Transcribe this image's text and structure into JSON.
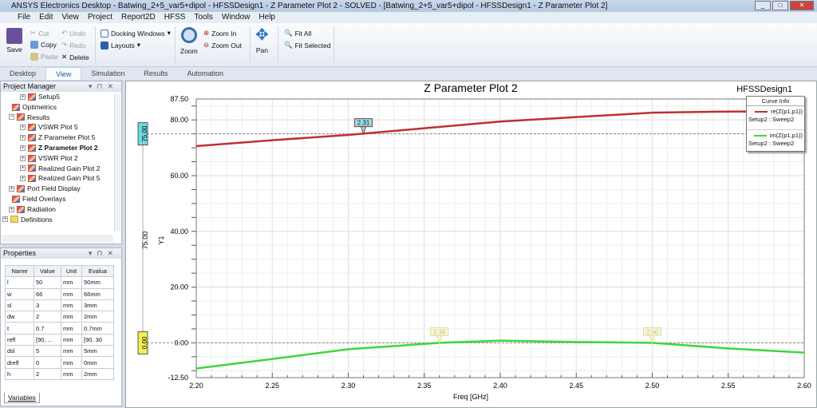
{
  "window": {
    "title": "ANSYS Electronics Desktop - Batwing_2+5_var5+dipol - HFSSDesign1 - Z Parameter Plot 2 - SOLVED - [Batwing_2+5_var5+dipol - HFSSDesign1 - Z Parameter Plot 2]"
  },
  "menu": [
    "File",
    "Edit",
    "View",
    "Project",
    "Report2D",
    "HFSS",
    "Tools",
    "Window",
    "Help"
  ],
  "ribbon": {
    "save": "Save",
    "cut": "Cut",
    "copy": "Copy",
    "paste": "Paste",
    "undo": "Undo",
    "redo": "Redo",
    "delete": "Delete",
    "docking": "Docking Windows",
    "layouts": "Layouts",
    "zoom": "Zoom",
    "zoom_in": "Zoom In",
    "zoom_out": "Zoom Out",
    "pan": "Pan",
    "fit_all": "Fit All",
    "fit_selected": "Fit Selected"
  },
  "tabs": [
    "Desktop",
    "View",
    "Simulation",
    "Results",
    "Automation"
  ],
  "project_manager": {
    "title": "Project Manager",
    "items": [
      "Setup5",
      "Optimetrics",
      "Results",
      "VSWR Plot 5",
      "Z Parameter Plot 5",
      "Z Parameter Plot 2",
      "VSWR Plot 2",
      "Realized Gain Plot 2",
      "Realized Gain Plot 5",
      "Port Field Display",
      "Field Overlays",
      "Radiation",
      "Definitions"
    ]
  },
  "properties": {
    "title": "Properties",
    "columns": [
      "Name",
      "Value",
      "Unit",
      "Evalua"
    ],
    "rows": [
      [
        "l",
        "50",
        "mm",
        "50mm"
      ],
      [
        "w",
        "66",
        "mm",
        "66mm"
      ],
      [
        "sl",
        "3",
        "mm",
        "3mm"
      ],
      [
        "dw",
        "2",
        "mm",
        "2mm"
      ],
      [
        "t",
        "0.7",
        "mm",
        "0.7mm"
      ],
      [
        "refl",
        "[90, ...",
        "mm",
        "[90, 30"
      ],
      [
        "dsl",
        "5",
        "mm",
        "5mm"
      ],
      [
        "drefl",
        "0",
        "mm",
        "0mm"
      ],
      [
        "h",
        "2",
        "mm",
        "2mm"
      ]
    ],
    "tab": "Variables"
  },
  "chart_data": {
    "type": "line",
    "title": "Z Parameter Plot 2",
    "design": "HFSSDesign1",
    "xlabel": "Freq [GHz]",
    "ylabel": "Y1",
    "xlim": [
      2.2,
      2.6
    ],
    "ylim": [
      -12.5,
      87.5
    ],
    "xticks": [
      "2.20",
      "2.25",
      "2.30",
      "2.35",
      "2.40",
      "2.45",
      "2.50",
      "2.55",
      "2.60"
    ],
    "yticks": [
      "87.50",
      "80.00",
      "60.00",
      "40.00",
      "20.00",
      "0.00",
      "-12.50"
    ],
    "legend_title": "Curve Info",
    "series": [
      {
        "name": "re(Z(p1,p1))",
        "sub": "Setup2 : Sweep2",
        "color": "#c0302f",
        "x": [
          2.2,
          2.25,
          2.3,
          2.35,
          2.4,
          2.45,
          2.5,
          2.55,
          2.6
        ],
        "y": [
          70.6,
          72.7,
          74.6,
          77.0,
          79.4,
          81.0,
          82.6,
          83.0,
          83.1
        ]
      },
      {
        "name": "im(Z(p1,p1))",
        "sub": "Setup2 : Sweep2",
        "color": "#3ed63e",
        "x": [
          2.2,
          2.25,
          2.3,
          2.35,
          2.36,
          2.4,
          2.45,
          2.5,
          2.55,
          2.6
        ],
        "y": [
          -9.2,
          -5.8,
          -2.3,
          -0.4,
          0,
          0.8,
          0.3,
          0,
          -2.0,
          -3.5
        ]
      }
    ],
    "markers": [
      {
        "label": "2.31",
        "x": 2.31,
        "y": 75
      },
      {
        "label": "2.36",
        "x": 2.36,
        "y": 0
      },
      {
        "label": "2.50",
        "x": 2.5,
        "y": 0
      }
    ],
    "hlines": [
      {
        "label": "75.00",
        "y": 75
      },
      {
        "label": "0.00",
        "y": 0
      }
    ],
    "side_label": "75.00"
  }
}
